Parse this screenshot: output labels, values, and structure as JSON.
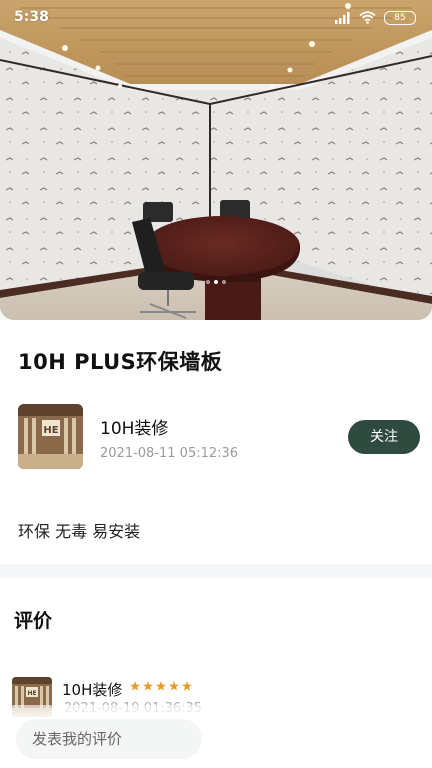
{
  "status_bar": {
    "time": "5:38",
    "battery": "85",
    "icons": [
      "signal-icon",
      "wifi-icon",
      "battery-icon"
    ]
  },
  "hero": {
    "carousel_dots": 3,
    "active_dot": 1
  },
  "post": {
    "title": "10H PLUS环保墙板",
    "author_name": "10H装修",
    "date": "2021-08-11 05:12:36",
    "follow_label": "关注",
    "description": "环保 无毒 易安装"
  },
  "reviews": {
    "heading": "评价",
    "items": [
      {
        "name": "10H装修",
        "rating": 5,
        "date": "2021-08-19 01:36:35"
      }
    ]
  },
  "comment": {
    "placeholder": "发表我的评价"
  },
  "colors": {
    "accent": "#2f4a3f",
    "star": "#e39b2a",
    "muted_text": "#9a9a9a"
  }
}
